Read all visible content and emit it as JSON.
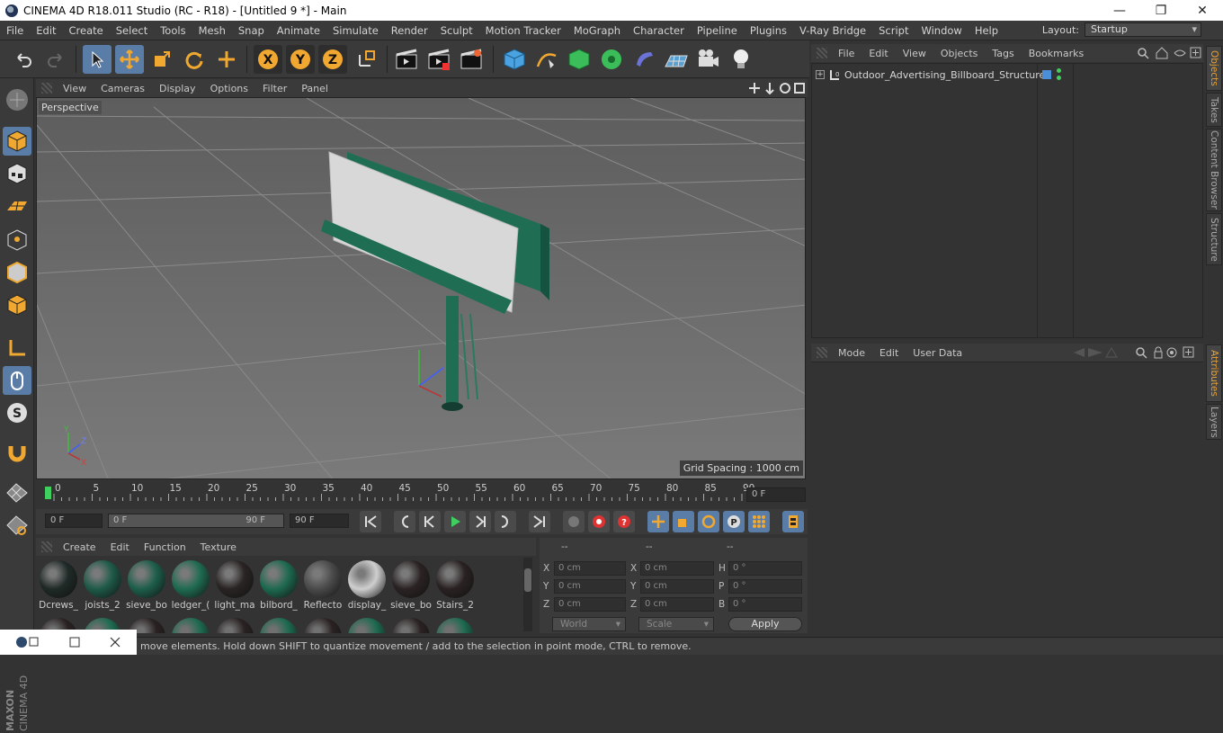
{
  "window": {
    "title": "CINEMA 4D R18.011 Studio (RC - R18) - [Untitled 9 *] - Main",
    "minimize_glyph": "—",
    "maximize_glyph": "❐",
    "close_glyph": "✕"
  },
  "menubar": {
    "items": [
      "File",
      "Edit",
      "Create",
      "Select",
      "Tools",
      "Mesh",
      "Snap",
      "Animate",
      "Simulate",
      "Render",
      "Sculpt",
      "Motion Tracker",
      "MoGraph",
      "Character",
      "Pipeline",
      "Plugins",
      "V-Ray Bridge",
      "Script",
      "Window",
      "Help"
    ],
    "layout_label": "Layout:",
    "layout_value": "Startup"
  },
  "viewport": {
    "menu": [
      "View",
      "Cameras",
      "Display",
      "Options",
      "Filter",
      "Panel"
    ],
    "camera_label": "Perspective",
    "grid_spacing": "Grid Spacing : 1000 cm",
    "axis_labels": {
      "x": "X",
      "y": "Y",
      "z": "Z"
    }
  },
  "timeline": {
    "ticks": [
      "0",
      "5",
      "10",
      "15",
      "20",
      "25",
      "30",
      "35",
      "40",
      "45",
      "50",
      "55",
      "60",
      "65",
      "70",
      "75",
      "80",
      "85",
      "90"
    ],
    "end_frame_field": "0 F",
    "start_field": "0 F",
    "range_start": "0 F",
    "range_end": "90 F",
    "end_field": "90 F"
  },
  "materials": {
    "menu": [
      "Create",
      "Edit",
      "Function",
      "Texture"
    ],
    "items": [
      {
        "label": "Dcrews_",
        "color": "#1f2a27"
      },
      {
        "label": "joists_2",
        "color": "#1e5a48"
      },
      {
        "label": "sieve_bo",
        "color": "#1d5e4a"
      },
      {
        "label": "ledger_(",
        "color": "#1f6b52"
      },
      {
        "label": "light_ma",
        "color": "#2a2424"
      },
      {
        "label": "bilbord_",
        "color": "#1e6a50"
      },
      {
        "label": "Reflecto",
        "color": "#4a4a4a"
      },
      {
        "label": "display_",
        "color": "#cfcfcf"
      },
      {
        "label": "sieve_bo",
        "color": "#2b2323"
      },
      {
        "label": "Stairs_2",
        "color": "#2a2222"
      }
    ]
  },
  "coords": {
    "headers": [
      "--",
      "--",
      "--"
    ],
    "rows": [
      {
        "a": "X",
        "av": "0 cm",
        "b": "X",
        "bv": "0 cm",
        "c": "H",
        "cv": "0 °"
      },
      {
        "a": "Y",
        "av": "0 cm",
        "b": "Y",
        "bv": "0 cm",
        "c": "P",
        "cv": "0 °"
      },
      {
        "a": "Z",
        "av": "0 cm",
        "b": "Z",
        "bv": "0 cm",
        "c": "B",
        "cv": "0 °"
      }
    ],
    "space_dropdown": "World",
    "mode_dropdown": "Scale",
    "apply_label": "Apply"
  },
  "objects": {
    "menu": [
      "File",
      "Edit",
      "View",
      "Objects",
      "Tags",
      "Bookmarks"
    ],
    "items": [
      {
        "name": "Outdoor_Advertising_Billboard_Structure"
      }
    ]
  },
  "attributes": {
    "menu": [
      "Mode",
      "Edit",
      "User Data"
    ]
  },
  "side_tabs": [
    "Objects",
    "Takes",
    "Content Browser",
    "Structure",
    "Attributes",
    "Layers"
  ],
  "status": "move elements. Hold down SHIFT to quantize movement / add to the selection in point mode, CTRL to remove.",
  "branding": {
    "line1": "MAXON",
    "line2": "CINEMA 4D"
  },
  "colors": {
    "accent": "#5a7da8",
    "bg": "#333333",
    "panel": "#3a3a3a",
    "tab_active": "#e6a23a"
  }
}
